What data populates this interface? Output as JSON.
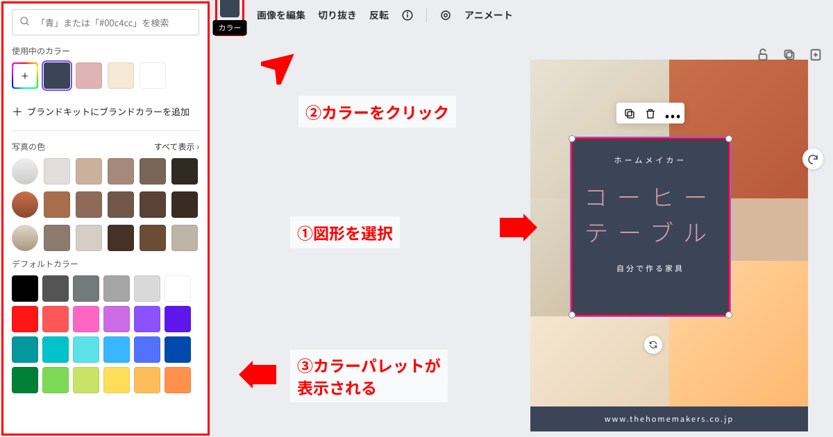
{
  "search": {
    "placeholder": "「青」または「#00c4cc」を検索"
  },
  "sections": {
    "current": "使用中のカラー",
    "brand_add": "ブランドキットにブランドカラーを追加",
    "photo": "写真の色",
    "see_all": "すべて表示",
    "default": "デフォルトカラー"
  },
  "current_colors": [
    "#3c4458",
    "#dfb2b4",
    "#f5e8d4",
    "#ffffff"
  ],
  "photo_colors": [
    [
      "#e3dddb",
      "#c9b19d",
      "#a5897a",
      "#796457",
      "#302a22"
    ],
    [
      "#a86d4b",
      "#8e6b58",
      "#71564a",
      "#5a4236",
      "#3a2c22"
    ],
    [
      "#8d7a6e",
      "#d6cec5",
      "#453128",
      "#6a4c37",
      "#bfb4a8"
    ]
  ],
  "default_colors": [
    [
      "#000000",
      "#545454",
      "#737a7a",
      "#a6a6a6",
      "#d9d9d9",
      "#ffffff"
    ],
    [
      "#ff1616",
      "#ff5757",
      "#ff66c4",
      "#cb6ce6",
      "#8c52ff",
      "#5e17eb"
    ],
    [
      "#03989e",
      "#00c2cb",
      "#5ce1e6",
      "#38b6ff",
      "#5271ff",
      "#004aad"
    ],
    [
      "#008037",
      "#7ed957",
      "#c9e265",
      "#ffde59",
      "#ffbd59",
      "#ff914d"
    ]
  ],
  "toolbar": {
    "color_tooltip": "カラー",
    "edit_image": "画像を編集",
    "crop": "切り抜き",
    "flip": "反転",
    "animate": "アニメート"
  },
  "shape": {
    "subtitle": "ホームメイカー",
    "title_l1": "コーヒー",
    "title_l2": "テーブル",
    "subtitle2": "自分で作る家具",
    "footer": "www.thehomemakers.co.jp"
  },
  "annotations": {
    "a1": "②カラーをクリック",
    "a2": "①図形を選択",
    "a3_l1": "③カラーパレットが",
    "a3_l2": "表示される"
  }
}
